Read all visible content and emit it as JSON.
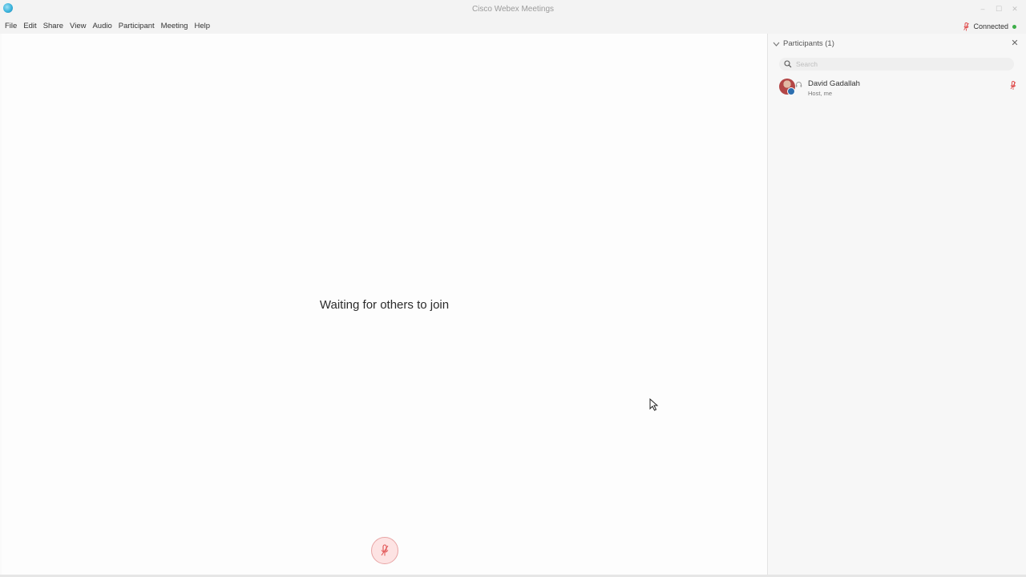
{
  "window": {
    "title": "Cisco Webex Meetings",
    "controls": {
      "minimize": "–",
      "maximize": "☐",
      "close": "✕"
    }
  },
  "menu": {
    "items": [
      {
        "label": "File"
      },
      {
        "label": "Edit"
      },
      {
        "label": "Share"
      },
      {
        "label": "View"
      },
      {
        "label": "Audio"
      },
      {
        "label": "Participant"
      },
      {
        "label": "Meeting"
      },
      {
        "label": "Help"
      }
    ],
    "status": {
      "label": "Connected",
      "color": "#3cae48",
      "mic_icon": "microphone-muted-icon"
    }
  },
  "stage": {
    "message": "Waiting for others to join",
    "mute_button_icon": "microphone-muted-icon",
    "mute_color": "#e05050"
  },
  "participants_panel": {
    "title": "Participants (1)",
    "close_label": "✕",
    "search": {
      "placeholder": "Search",
      "value": ""
    },
    "participants": [
      {
        "name": "David Gadallah",
        "role": "Host, me",
        "avatar_icon": "avatar-photo",
        "audio_icon": "headset-icon",
        "mic_icon": "microphone-muted-icon"
      }
    ]
  }
}
